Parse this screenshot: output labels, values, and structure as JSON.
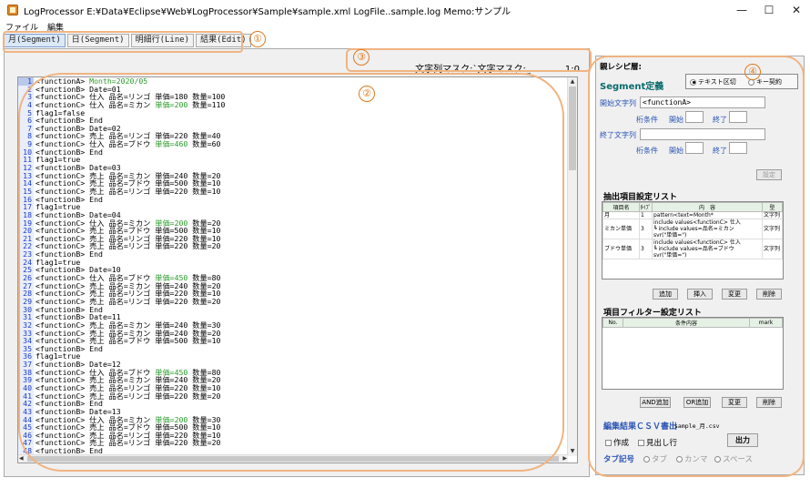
{
  "window": {
    "title": "LogProcessor   E:¥Data¥Eclipse¥Web¥LogProcessor¥Sample¥sample.xml  LogFile..sample.log  Memo:サンプル",
    "minimize": "—",
    "maximize": "☐",
    "close": "✕"
  },
  "menu": [
    "ファイル",
    "編集"
  ],
  "tabs": [
    "月(Segment)",
    "日(Segment)",
    "明細行(Line)",
    "結果(Edit)"
  ],
  "annotations": [
    "①",
    "②",
    "③",
    "④"
  ],
  "status": {
    "mask_text": "文字列マスク:`文字マスク:_",
    "position": "1:0"
  },
  "code_lines": [
    {
      "n": "1",
      "t": "<functionA> ",
      "g": "Month=2020/05"
    },
    {
      "n": "2",
      "t": "<functionB> Date=01"
    },
    {
      "n": "3",
      "t": "<functionC> 仕入 品名=リンゴ 単価=180 数量=100"
    },
    {
      "n": "4",
      "t": "<functionC> 仕入 品名=ミカン ",
      "g": "単価=200",
      "t2": " 数量=110"
    },
    {
      "n": "5",
      "t": "flag1=false"
    },
    {
      "n": "6",
      "t": "<functionB> End"
    },
    {
      "n": "7",
      "t": "<functionB> Date=02"
    },
    {
      "n": "8",
      "t": "<functionC> 売上 品名=リンゴ 単価=220 数量=40"
    },
    {
      "n": "9",
      "t": "<functionC> 仕入 品名=ブドウ ",
      "g": "単価=460",
      "t2": " 数量=60"
    },
    {
      "n": "10",
      "t": "<functionB> End"
    },
    {
      "n": "11",
      "t": "flag1=true"
    },
    {
      "n": "12",
      "t": "<functionB> Date=03"
    },
    {
      "n": "13",
      "t": "<functionC> 売上 品名=ミカン 単価=240 数量=20"
    },
    {
      "n": "14",
      "t": "<functionC> 売上 品名=ブドウ 単価=500 数量=10"
    },
    {
      "n": "15",
      "t": "<functionC> 売上 品名=リンゴ 単価=220 数量=10"
    },
    {
      "n": "16",
      "t": "<functionB> End"
    },
    {
      "n": "17",
      "t": "flag1=true"
    },
    {
      "n": "18",
      "t": "<functionB> Date=04"
    },
    {
      "n": "19",
      "t": "<functionC> 仕入 品名=ミカン ",
      "g": "単価=200",
      "t2": " 数量=20"
    },
    {
      "n": "20",
      "t": "<functionC> 売上 品名=ブドウ 単価=500 数量=10"
    },
    {
      "n": "21",
      "t": "<functionC> 売上 品名=リンゴ 単価=220 数量=10"
    },
    {
      "n": "22",
      "t": "<functionC> 売上 品名=リンゴ 単価=220 数量=20"
    },
    {
      "n": "23",
      "t": "<functionB> End"
    },
    {
      "n": "24",
      "t": "flag1=true"
    },
    {
      "n": "25",
      "t": "<functionB> Date=10"
    },
    {
      "n": "26",
      "t": "<functionC> 仕入 品名=ブドウ ",
      "g": "単価=450",
      "t2": " 数量=80"
    },
    {
      "n": "27",
      "t": "<functionC> 売上 品名=ミカン 単価=240 数量=20"
    },
    {
      "n": "28",
      "t": "<functionC> 売上 品名=リンゴ 単価=220 数量=10"
    },
    {
      "n": "29",
      "t": "<functionC> 売上 品名=リンゴ 単価=220 数量=20"
    },
    {
      "n": "30",
      "t": "<functionB> End"
    },
    {
      "n": "31",
      "t": "<functionB> Date=11"
    },
    {
      "n": "32",
      "t": "<functionC> 売上 品名=ミカン 単価=240 数量=30"
    },
    {
      "n": "33",
      "t": "<functionC> 売上 品名=ミカン 単価=240 数量=20"
    },
    {
      "n": "34",
      "t": "<functionC> 売上 品名=ブドウ 単価=500 数量=10"
    },
    {
      "n": "35",
      "t": "<functionB> End"
    },
    {
      "n": "36",
      "t": "flag1=true"
    },
    {
      "n": "37",
      "t": "<functionB> Date=12"
    },
    {
      "n": "38",
      "t": "<functionC> 仕入 品名=ブドウ ",
      "g": "単価=450",
      "t2": " 数量=80"
    },
    {
      "n": "39",
      "t": "<functionC> 売上 品名=ミカン 単価=240 数量=20"
    },
    {
      "n": "40",
      "t": "<functionC> 売上 品名=リンゴ 単価=220 数量=10"
    },
    {
      "n": "41",
      "t": "<functionC> 売上 品名=リンゴ 単価=220 数量=20"
    },
    {
      "n": "42",
      "t": "<functionB> End"
    },
    {
      "n": "43",
      "t": "<functionB> Date=13"
    },
    {
      "n": "44",
      "t": "<functionC> 仕入 品名=ミカン ",
      "g": "単価=200",
      "t2": " 数量=30"
    },
    {
      "n": "45",
      "t": "<functionC> 売上 品名=ブドウ 単価=500 数量=10"
    },
    {
      "n": "46",
      "t": "<functionC> 売上 品名=リンゴ 単価=220 数量=10"
    },
    {
      "n": "47",
      "t": "<functionC> 売上 品名=リンゴ 単価=220 数量=20"
    },
    {
      "n": "48",
      "t": "<functionB> End"
    },
    {
      "n": "49",
      "t": "flag1=true"
    }
  ],
  "right": {
    "parent_label": "親レシピ層:",
    "segment_title": "Segment定義",
    "radio_text": "テキスト区切",
    "radio_key": "キー契約",
    "start_label": "開始文字列",
    "start_value": "<functionA>",
    "digit_cond": "桁条件",
    "start": "開始",
    "end": "終了",
    "end_label": "終了文字列",
    "set_button": "設定",
    "extract_title": "抽出項目設定リスト",
    "extract_headers": [
      "項目名",
      "ﾀｲﾌﾟ",
      "内　容",
      "型"
    ],
    "extract_rows": [
      [
        "月",
        "1",
        "pattern<text=Month*",
        "文字列"
      ],
      [
        "ミカン単価",
        "3",
        "include values<functionC> 仕入\n  ┗ include values=品名=ミカン\n  svr(\"単価=\")",
        "文字列"
      ],
      [
        "ブドウ単価",
        "3",
        "include values<functionC> 仕入\n  ┗ include values=品名=ブドウ\n  svr(\"単価=\")",
        "文字列"
      ]
    ],
    "extract_buttons": [
      "追加",
      "挿入",
      "変更",
      "削除"
    ],
    "filter_title": "項目フィルター設定リスト",
    "filter_headers": [
      "No.",
      "条件内容",
      "mark"
    ],
    "filter_buttons": [
      "AND追加",
      "OR追加",
      "変更",
      "削除"
    ],
    "output_title": "編集結果ＣＳＶ書出",
    "output_file": "sample_月.csv",
    "create_label": "作成",
    "header_label": "見出し行",
    "output_button": "出力",
    "tab_label": "タブ記号",
    "tab_options": [
      "タブ",
      "カンマ",
      "スペース"
    ]
  },
  "colors": {
    "accent": "#2a55b5",
    "annotation": "#e07a20",
    "highlight_green": "#2a9a2a"
  }
}
